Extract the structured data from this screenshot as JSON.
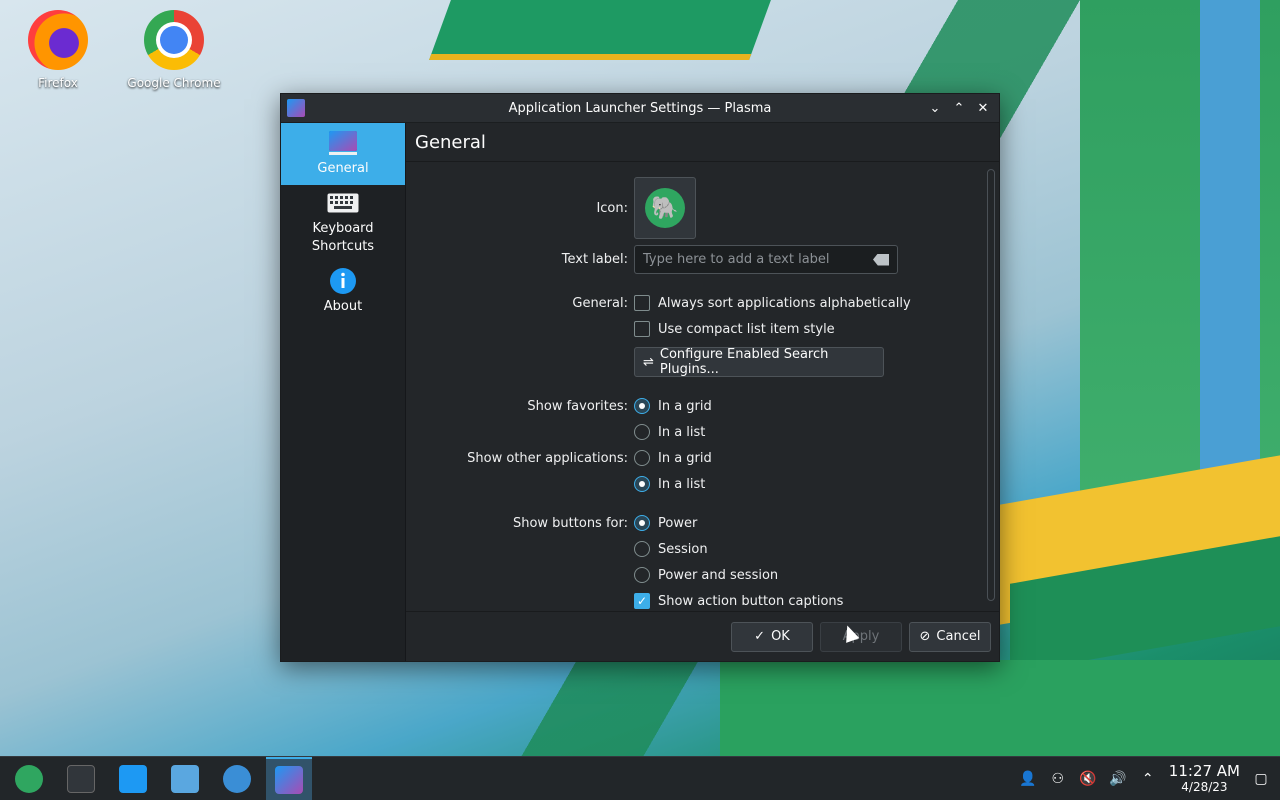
{
  "desktop": {
    "icons": [
      {
        "label": "Firefox",
        "icon": "firefox-icon"
      },
      {
        "label": "Google Chrome",
        "icon": "chrome-icon"
      }
    ]
  },
  "window": {
    "title": "Application Launcher Settings — Plasma",
    "controls": {
      "minimize": "⌄",
      "maximize": "⌃",
      "close": "✕"
    }
  },
  "sidebar": {
    "items": [
      {
        "label": "General",
        "icon": "launcher-icon",
        "active": true
      },
      {
        "label": "Keyboard Shortcuts",
        "icon": "keyboard-icon",
        "active": false
      },
      {
        "label": "About",
        "icon": "info-icon",
        "active": false
      }
    ]
  },
  "page": {
    "title": "General",
    "icon_label": "Icon:",
    "text_label": "Text label:",
    "text_placeholder": "Type here to add a text label",
    "general_label": "General:",
    "sort_alpha": "Always sort applications alphabetically",
    "compact_list": "Use compact list item style",
    "configure_btn": "Configure Enabled Search Plugins...",
    "favorites_label": "Show favorites:",
    "fav_grid": "In a grid",
    "fav_list": "In a list",
    "other_label": "Show other applications:",
    "other_grid": "In a grid",
    "other_list": "In a list",
    "buttons_label": "Show buttons for:",
    "btn_power": "Power",
    "btn_session": "Session",
    "btn_power_session": "Power and session",
    "captions": "Show action button captions"
  },
  "footer": {
    "ok": "OK",
    "apply": "Apply",
    "cancel": "Cancel"
  },
  "taskbar": {
    "time": "11:27 AM",
    "date": "4/28/23"
  },
  "colors": {
    "accent": "#3daee9",
    "window_bg": "#232629"
  }
}
